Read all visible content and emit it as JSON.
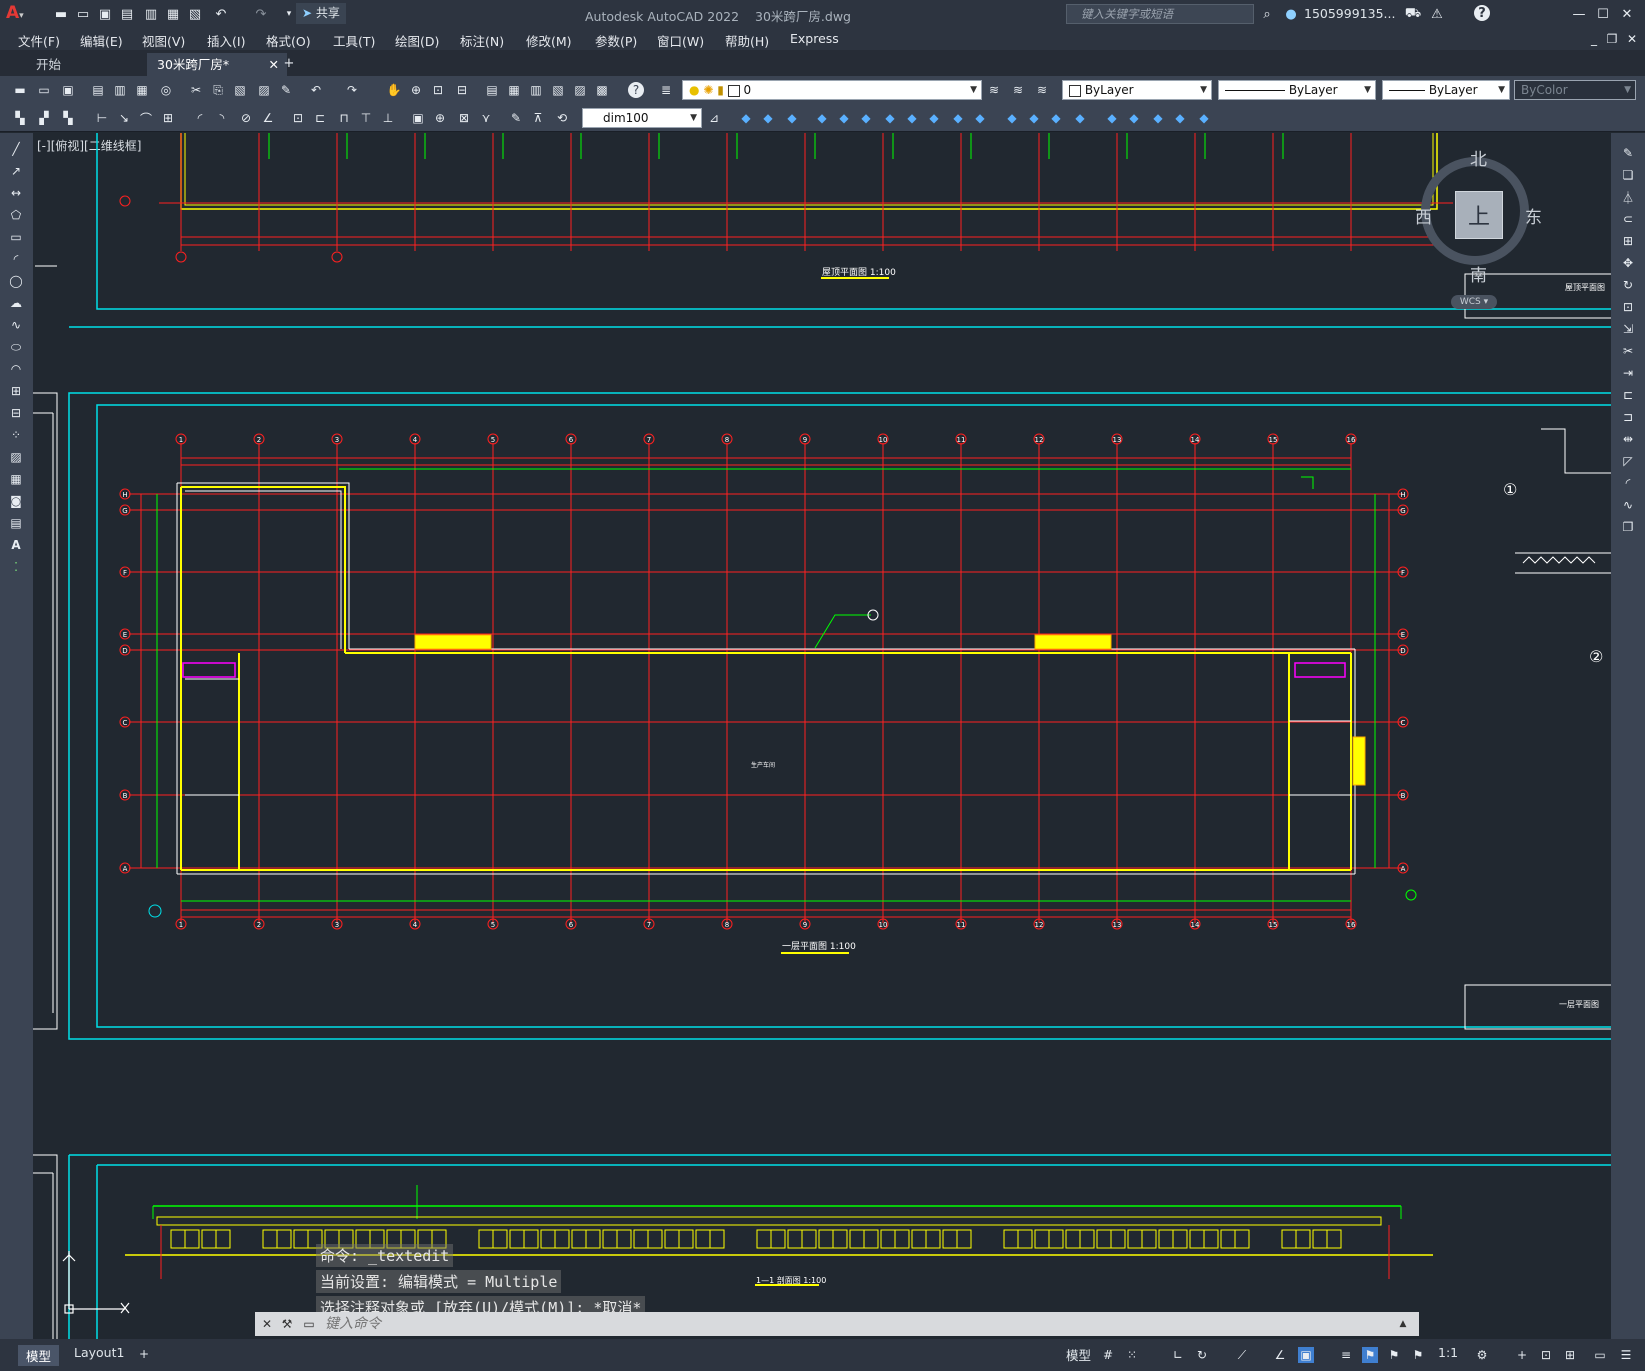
{
  "titlebar": {
    "app_title": "Autodesk AutoCAD 2022",
    "file_name": "30米跨厂房.dwg",
    "share_label": "共享",
    "search_placeholder": "键入关键字或短语",
    "user": "1505999135..."
  },
  "menu": [
    "文件(F)",
    "编辑(E)",
    "视图(V)",
    "插入(I)",
    "格式(O)",
    "工具(T)",
    "绘图(D)",
    "标注(N)",
    "修改(M)",
    "参数(P)",
    "窗口(W)",
    "帮助(H)",
    "Express"
  ],
  "tabs": {
    "start": "开始",
    "active": "30米跨厂房*"
  },
  "toolbar": {
    "layer_value": "0",
    "color_value": "ByLayer",
    "linetype_value": "ByLayer",
    "lineweight_value": "ByLayer",
    "plotstyle_value": "ByColor",
    "dimstyle_value": "dim100"
  },
  "viewport_label": "[-][俯视][二维线框]",
  "viewcube": {
    "north": "北",
    "south": "南",
    "east": "东",
    "west": "西",
    "face": "上",
    "wcs": "WCS"
  },
  "drawing": {
    "roof_title": "屋顶平面图 1:100",
    "roof_table_label": "屋顶平面图",
    "floor_title": "一层平面图 1:100",
    "floor_table_label": "一层平面图",
    "section_title": "1—1 剖面图 1:100",
    "room_label": "生产车间",
    "axes_numbers": [
      "1",
      "2",
      "3",
      "4",
      "5",
      "6",
      "7",
      "8",
      "9",
      "10",
      "11",
      "12",
      "13",
      "14",
      "15",
      "16"
    ],
    "axes_letters": [
      "H",
      "G",
      "F",
      "E",
      "D",
      "C",
      "B",
      "A"
    ],
    "detail_1": "①",
    "detail_2": "②"
  },
  "command": {
    "line1": "命令: _textedit",
    "line2": "当前设置: 编辑模式 = Multiple",
    "line3": "选择注释对象或 [放弃(U)/模式(M)]: *取消*",
    "placeholder": "键入命令"
  },
  "status": {
    "model_tab": "模型",
    "layout_tab": "Layout1",
    "model_btn": "模型",
    "scale": "1:1"
  },
  "colors": {
    "grid_red": "#ff2020",
    "wall_yellow": "#ffff00",
    "dim_green": "#00ff00",
    "frame_cyan": "#00e0e8",
    "background": "#212830"
  }
}
